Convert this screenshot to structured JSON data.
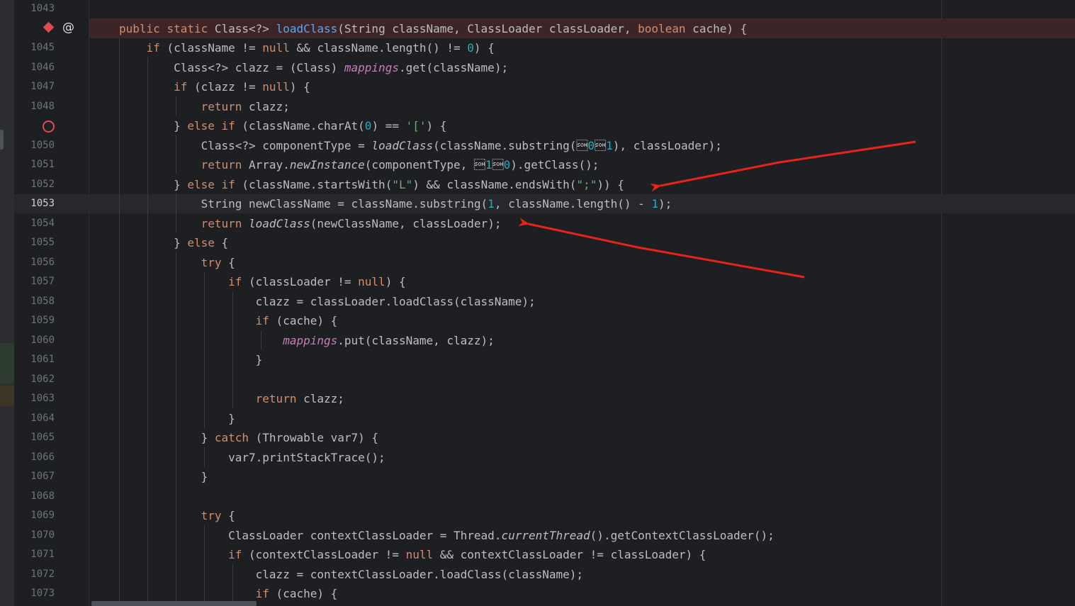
{
  "editor": {
    "language": "Java",
    "current_line": 1053,
    "line_numbers": [
      "1043",
      "",
      "1045",
      "1046",
      "1047",
      "1048",
      "",
      "1050",
      "1051",
      "1052",
      "1053",
      "1054",
      "1055",
      "1056",
      "1057",
      "1058",
      "1059",
      "1060",
      "1061",
      "1062",
      "1063",
      "1064",
      "1065",
      "1066",
      "1067",
      "1068",
      "1069",
      "1070",
      "1071",
      "1072",
      "1073"
    ],
    "gutter_icons": {
      "method_breakpoint": "diamond-breakpoint-icon",
      "implements_marker": "@",
      "line_breakpoint": "disabled-breakpoint-icon"
    },
    "inlay_hints": {
      "begin_index": "beginIndex:",
      "length": "length:"
    },
    "lines": [
      "",
      "public static Class<?> loadClass(String className, ClassLoader classLoader, boolean cache) {",
      "    if (className != null && className.length() != 0) {",
      "        Class<?> clazz = (Class) mappings.get(className);",
      "        if (clazz != null) {",
      "            return clazz;",
      "        } else if (className.charAt(0) == '[') {",
      "            Class<?> componentType = loadClass(className.substring(beginIndex: 1), classLoader);",
      "            return Array.newInstance(componentType, length: 0).getClass();",
      "        } else if (className.startsWith(\"L\") && className.endsWith(\";\")) {",
      "            String newClassName = className.substring(1, className.length() - 1);",
      "            return loadClass(newClassName, classLoader);",
      "        } else {",
      "            try {",
      "                if (classLoader != null) {",
      "                    clazz = classLoader.loadClass(className);",
      "                    if (cache) {",
      "                        mappings.put(className, clazz);",
      "                    }",
      "",
      "                    return clazz;",
      "                }",
      "            } catch (Throwable var7) {",
      "                var7.printStackTrace();",
      "            }",
      "",
      "            try {",
      "                ClassLoader contextClassLoader = Thread.currentThread().getContextClassLoader();",
      "                if (contextClassLoader != null && contextClassLoader != classLoader) {",
      "                    clazz = contextClassLoader.loadClass(className);",
      "                    if (cache) {"
    ],
    "colors": {
      "background": "#1e1f22",
      "keyword": "#cf8e6d",
      "method_declaration": "#56a8f5",
      "number": "#2aacb8",
      "string": "#6aab73",
      "static_field": "#c77dbb",
      "annotation_arrow": "#e8231a",
      "breakpoint": "#e5484d"
    }
  }
}
